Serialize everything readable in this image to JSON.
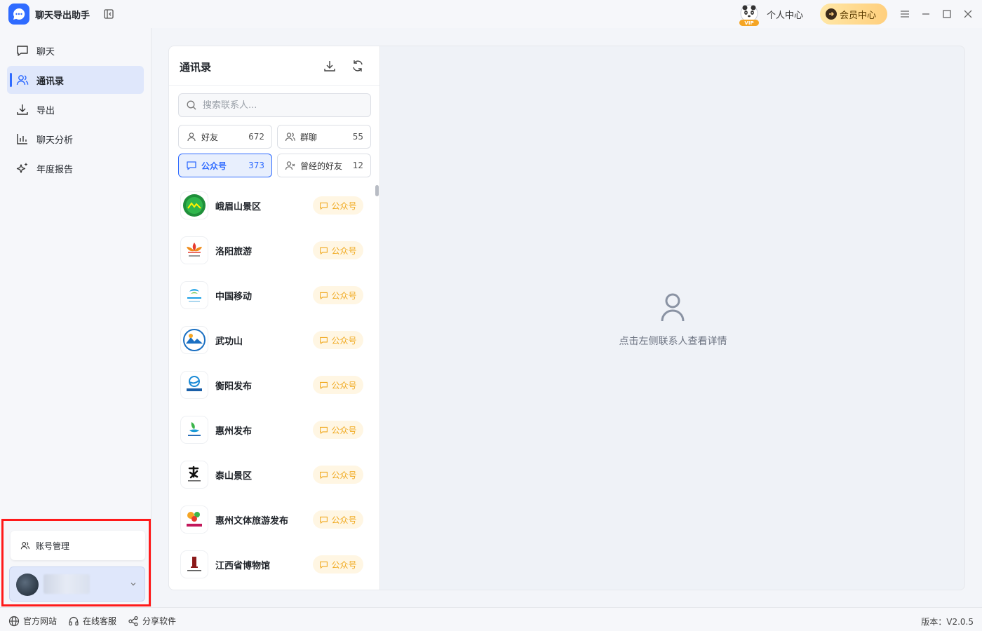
{
  "app": {
    "title": "聊天导出助手"
  },
  "titlebar": {
    "personal_center": "个人中心",
    "member_center": "会员中心",
    "vip_badge": "VIP"
  },
  "sidebar": {
    "items": [
      {
        "label": "聊天",
        "icon": "chat-icon"
      },
      {
        "label": "通讯录",
        "icon": "contacts-icon",
        "active": true
      },
      {
        "label": "导出",
        "icon": "download-icon"
      },
      {
        "label": "聊天分析",
        "icon": "bar-chart-icon"
      },
      {
        "label": "年度报告",
        "icon": "sparkle-icon"
      }
    ],
    "account_manage": "账号管理"
  },
  "contacts": {
    "title": "通讯录",
    "search_placeholder": "搜索联系人...",
    "filters": [
      {
        "label": "好友",
        "count": "672"
      },
      {
        "label": "群聊",
        "count": "55"
      },
      {
        "label": "公众号",
        "count": "373",
        "active": true
      },
      {
        "label": "曾经的好友",
        "count": "12"
      }
    ],
    "tag_label": "公众号",
    "rows": [
      {
        "name": "峨眉山景区"
      },
      {
        "name": "洛阳旅游"
      },
      {
        "name": "中国移动"
      },
      {
        "name": "武功山"
      },
      {
        "name": "衡阳发布"
      },
      {
        "name": "惠州发布"
      },
      {
        "name": "泰山景区"
      },
      {
        "name": "惠州文体旅游发布"
      },
      {
        "name": "江西省博物馆"
      }
    ]
  },
  "detail": {
    "placeholder": "点击左侧联系人查看详情"
  },
  "footer": {
    "website": "官方网站",
    "support": "在线客服",
    "share": "分享软件",
    "version": "版本：V2.0.5"
  },
  "colors": {
    "accent": "#2f6bff",
    "tag_text": "#f0a91f",
    "tag_bg": "#fff6e3",
    "highlight_border": "#ff1a1a"
  }
}
